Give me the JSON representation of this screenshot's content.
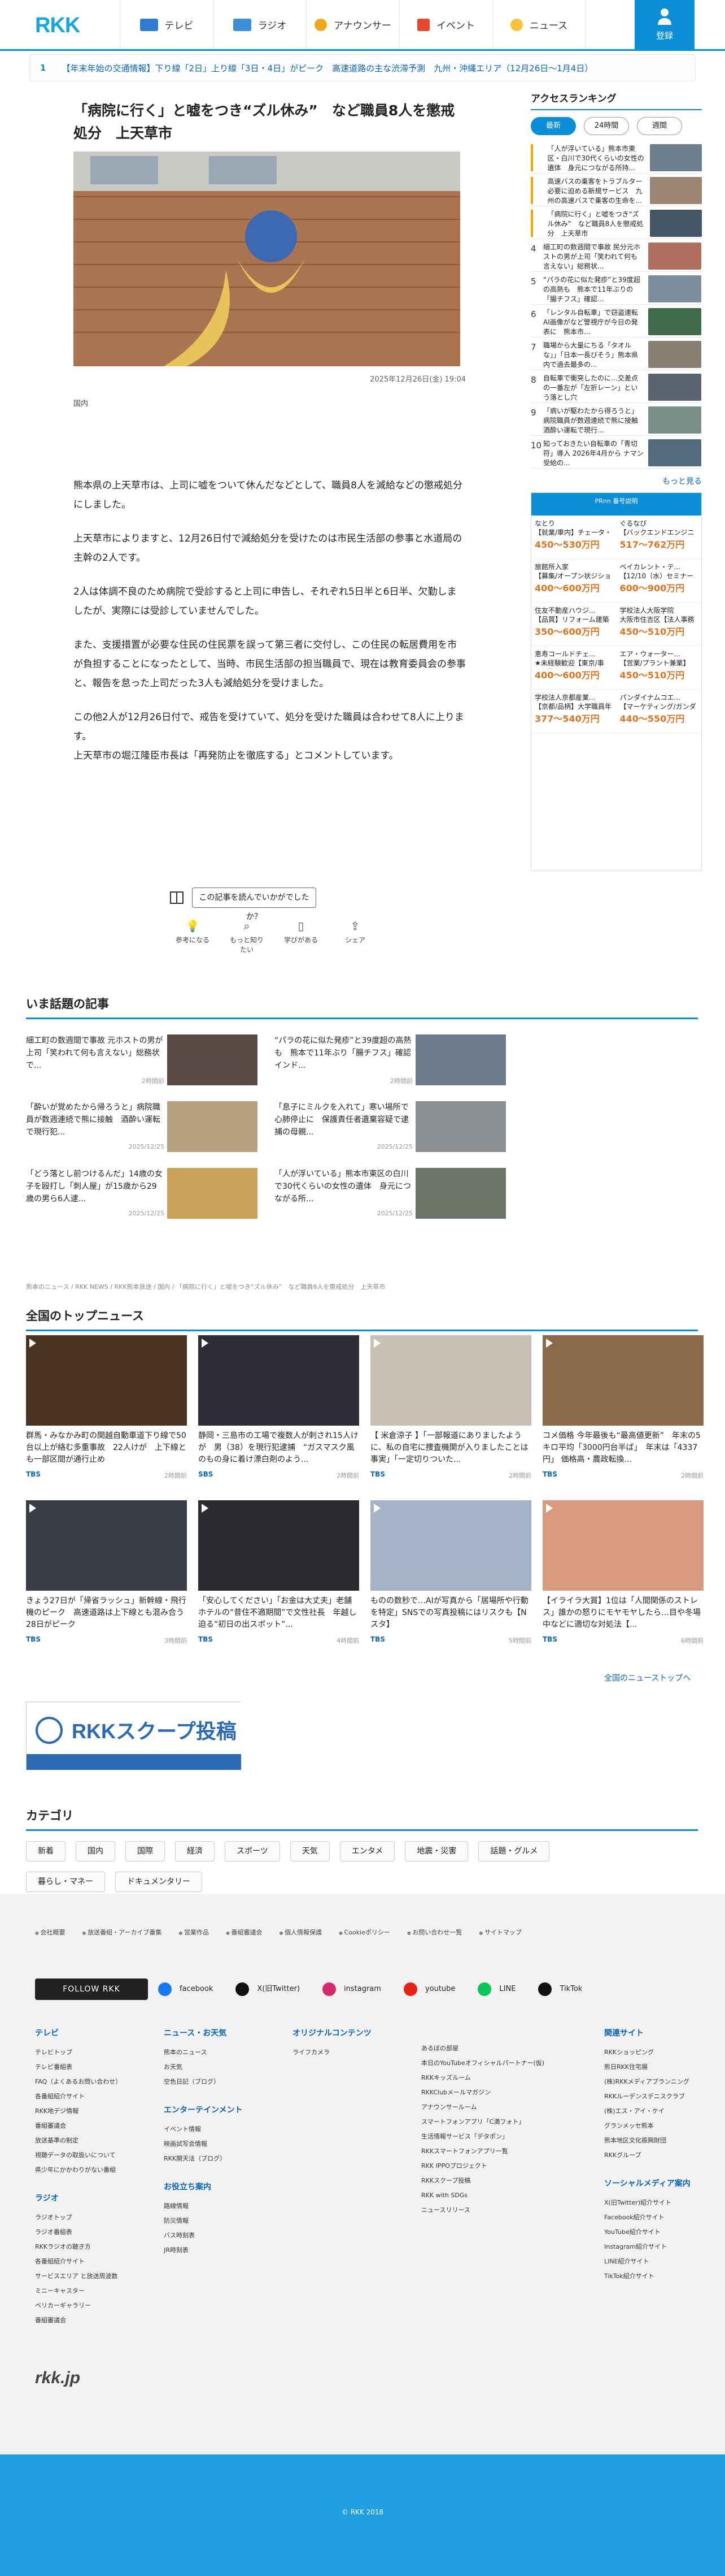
{
  "header": {
    "logo": "RKK",
    "nav": [
      "テレビ",
      "ラジオ",
      "アナウンサー",
      "イベント",
      "ニュース"
    ],
    "login": "登録"
  },
  "ticker": {
    "num": "1",
    "text": "【年末年始の交通情報】下り線「2日」上り線「3日・4日」がピーク　高速道路の主な渋滞予測　九州・沖縄エリア（12月26日〜1月4日）"
  },
  "article": {
    "title": "「病院に行く」と嘘をつき“ズル休み”　など職員8人を懲戒処分　上天草市",
    "date": "2025年12月26日(金) 19:04",
    "category": "国内",
    "paragraphs": [
      "熊本県の上天草市は、上司に嘘をついて休んだなどとして、職員8人を減給などの懲戒処分にしました。",
      "上天草市によりますと、12月26日付で減給処分を受けたのは市民生活部の参事と水道局の主幹の2人です。",
      "2人は体調不良のため病院で受診すると上司に申告し、それぞれ5日半と6日半、欠勤しましたが、実際には受診していませんでした。",
      "また、支援措置が必要な住民の住民票を誤って第三者に交付し、この住民の転居費用を市が負担することになったとして、当時、市民生活部の担当職員で、現在は教育委員会の参事と、報告を怠った上司だった3人も減給処分を受けました。",
      "この他2人が12月26日付で、戒告を受けていて、処分を受けた職員は合わせて8人に上ります。\n上天草市の堀江隆臣市長は「再発防止を徹底する」とコメントしています。"
    ],
    "question": "この記事を読んでいかがでしたか？",
    "reactions": [
      "参考になる",
      "もっと知りたい",
      "学びがある",
      "シェア"
    ]
  },
  "ranking": {
    "title": "アクセスランキング",
    "tabs": [
      "最新",
      "24時間",
      "週間"
    ],
    "items": [
      {
        "n": "",
        "t": "「人が浮いている」熊本市東区・白川で30代くらいの女性の遺体　身元につながる所持..."
      },
      {
        "n": "",
        "t": "高速バスの乗客をトラブルター必要に迫める新規サービス　九州の高速バスで乗客の生命を..."
      },
      {
        "n": "",
        "t": "「病院に行く」と嘘をつき“ズル休み”　など職員8人を懲戒処分　上天草市"
      },
      {
        "n": "4",
        "t": "細工町の数週間で事故 民分元ホストの男が上司「笑われて何も言えない」総務状..."
      },
      {
        "n": "5",
        "t": "“パラの花に似た発疹”と39度超の高熱も　熊本で11年ぶりの「腸チフス」確認..."
      },
      {
        "n": "6",
        "t": "「レンタル自転車」で窃盗連転 AI画像がなど警視庁が今日の発表に　熊本市..."
      },
      {
        "n": "7",
        "t": "職場から大量にちる「タオルな」」「日本一長びそう」熊本県内で過去最多の..."
      },
      {
        "n": "8",
        "t": "自転車で衝突したのに…交差点の一番左が「左折レーン」という落とし穴"
      },
      {
        "n": "9",
        "t": "「病いが駆わたから得ろうと」病院職員が数週連続で熊に接触　酒酔い運転で現行..."
      },
      {
        "n": "10",
        "t": "知っておきたい自転車の「青切符」導入 2026年4月から ナマン受給の..."
      }
    ],
    "more": "もっと見る"
  },
  "ad": {
    "top": "PRnn 番号説明",
    "items": [
      {
        "t": "なとり\n【就業/車内】チェータ・ロールカバスで入院",
        "p": "450〜530万円"
      },
      {
        "t": "ぐるなび\n【バックエンドエンジニア（ぐるなび）】",
        "p": "517〜762万円"
      },
      {
        "t": "旅館所入家\n【募集/オープン状ジション】営業部の...",
        "p": "400〜600万円"
      },
      {
        "t": "ベイカレント・テ...\n【12/10（水）セミナー開催/ITエンジニア...",
        "p": "600〜900万円"
      },
      {
        "t": "住友不動産ハウジ...\n【品質】リフォーム建築施工管理職/未...",
        "p": "350〜600万円"
      },
      {
        "t": "学校法人大阪学院\n大阪市住吉区【法人事務局/大学の高校..】",
        "p": "450〜510万円"
      },
      {
        "t": "恵寿コールドチェ...\n★未経験歓迎【東京/事務】「資訊ため」を...",
        "p": "400〜600万円"
      },
      {
        "t": "エア・ウォーター...\n【営業/プラント兼業】（空調・冷蔵・冷凍...",
        "p": "450〜510万円"
      },
      {
        "t": "学校法人京都産業...\n【京都/品柄】大学職員年令年3日の...",
        "p": "377〜540万円"
      },
      {
        "t": "パンダイナムコエ...\n【マーケティング/ガンダムコンテンツ...",
        "p": "440〜550万円"
      }
    ]
  },
  "topics": {
    "title": "いま話題の記事",
    "items": [
      {
        "t": "細工町の数週間で事故 元ホストの男が上司「笑われて何も言えない」総務状で...",
        "m": "2時間前"
      },
      {
        "t": "“パラの花に似た発疹”と39度超の高熱も　熊本で11年ぶり「腸チフス」確認　インド...",
        "m": "2時間前"
      },
      {
        "t": "「酔いが覚めたから帰ろうと」病院職員が数週連続で熊に接触　酒酔い運転で現行犯...",
        "m": "2025/12/25"
      },
      {
        "t": "「息子にミルクを入れて」寒い場所で心肺停止に　保護責任者遺棄容疑で逮捕の母親...",
        "m": "2025/12/25"
      },
      {
        "t": "「どう落とし前つけるんだ」14歳の女子を殴打し「刺人屋」が15歳から29歳の男ら6人逮...",
        "m": "2025/12/25"
      },
      {
        "t": "「人が浮いている」熊本市東区の白川で30代くらいの女性の遺体　身元につながる所...",
        "m": "2025/12/25"
      }
    ]
  },
  "breadcrumb": "熊本のニュース / RKK NEWS / RKK熊本放送 / 国内 / 「病院に行く」と嘘をつき“ズル休み”　など職員8人を懲戒処分　上天草市",
  "topnews": {
    "title": "全国のトップニュース",
    "items": [
      {
        "t": "群馬・みなかみ町の関越自動車道下り線で50台以上が絡む多重事故　22人けが　上下線とも一部区間が通行止め",
        "s": "TBS",
        "d": "2時間前"
      },
      {
        "t": "静岡・三島市の工場で複数人が刺され15人けが　男（38）を現行犯逮捕　“ガスマスク風のもの身に着け漂白剤のよう...",
        "s": "SBS",
        "d": "2時間前"
      },
      {
        "t": "【 米倉涼子 】「一部報道にありましたように、私の自宅に捜査機関が入りましたことは事実」「一定切りついた...",
        "s": "TBS",
        "d": "2時間前"
      },
      {
        "t": "コメ価格 今年最後も“最高値更新”　年末の5キロ平均「3000円台半ば」　年末は「4337円」 価格高・農政転換...",
        "s": "TBS",
        "d": "2時間前"
      },
      {
        "t": "きょう27日が「帰省ラッシュ」新幹線・飛行機のピーク　高速道路は上下線とも混み合う28日がピーク",
        "s": "TBS",
        "d": "3時間前"
      },
      {
        "t": "「安心してください」「お金は大丈夫」老舗ホテルの“昔住不適期間”で文性社長　年越し迫る“初日の出スポット”...",
        "s": "TBS",
        "d": "4時間前"
      },
      {
        "t": "ものの数秒で…AIが写真から「居場所や行動を特定」SNSでの写真投稿にはリスクも【N スタ】",
        "s": "TBS",
        "d": "5時間前"
      },
      {
        "t": "【イライラ大賞】1位は「人間関係のストレス」誰かの怒りにモヤモヤしたら…目や冬場中などに適切な対処法【...",
        "s": "TBS",
        "d": "6時間前"
      }
    ],
    "all": "全国のニューストップへ"
  },
  "banner": {
    "text": "RKKスクープ投稿"
  },
  "categories": {
    "title": "カテゴリ",
    "items": [
      "新着",
      "国内",
      "国際",
      "経済",
      "スポーツ",
      "天気",
      "エンタメ",
      "地震・災害",
      "話題・グルメ",
      "暮らし・マネー",
      "ドキュメンタリー"
    ]
  },
  "footer": {
    "links": [
      "会社概要",
      "放送番組・アーカイブ番集",
      "営業作品",
      "番組審議会",
      "個人情報保護",
      "Cookieポリシー",
      "お問い合わせ一覧",
      "サイトマップ"
    ],
    "follow": "FOLLOW RKK",
    "social": [
      "facebook",
      "X(旧Twitter)",
      "instagram",
      "youtube",
      "LINE",
      "TikTok"
    ],
    "cols": [
      {
        "h": "テレビ",
        "items": [
          "テレビトップ",
          "テレビ番組表",
          "FAQ（よくあるお問い合わせ）",
          "各番組紹介サイト",
          "RKK地デジ情報",
          "番組審議会",
          "放送基準の制定",
          "視聴データの取扱いについて",
          "県少年にかかわりがない番組"
        ]
      },
      {
        "h": "ニュース・お天気",
        "items": [
          "熊本のニュース",
          "お天気",
          "空色日記（ブログ）"
        ]
      },
      {
        "h": "オリジナルコンテンツ",
        "items": [
          "ライフカメラ"
        ]
      },
      {
        "h": "",
        "items": [
          "あるぼの部屋",
          "本日のYouTubeオフィシャルパートナー(仮)",
          "RKKキッズルーム",
          "RKKClubメールマガジン",
          "アナウンサールーム",
          "スマートフォンアプリ「C満フォト」",
          "生活情報サービス「デタポン」",
          "RKKスマートフォンアプリ一覧",
          "RKK IPPOプロジェクト",
          "RKKスクープ投稿",
          "RKK with SDGs",
          "ニュースリリース"
        ]
      },
      {
        "h": "関連サイト",
        "items": [
          "RKKショッピング",
          "熊日RKK住宅展",
          "(株)RKKメディアプランニング",
          "RKKルーデンスデニスクラブ",
          "(株)エス・アイ・ケイ",
          "グランメッセ熊本",
          "熊本地区文化振興財団",
          "RKKグループ"
        ]
      }
    ],
    "cols2": [
      {
        "h": "ラジオ",
        "items": [
          "ラジオトップ",
          "ラジオ番組表",
          "RKKラジオの聴き方",
          "各番組紹介サイト",
          "サービスエリア と放送周波数",
          "ミニーキャスター",
          "ベリカーギャラリー",
          "番組審議会"
        ]
      },
      {
        "h": "エンターテインメント",
        "items": [
          "イベント情報",
          "映画試写会情報",
          "RKK開天法（ブログ）"
        ]
      },
      {
        "h": "お役立ち案内",
        "items": [
          "路線情報",
          "防災情報",
          "バス時刻表",
          "JR時刻表"
        ]
      },
      {
        "h": "ソーシャルメディア案内",
        "items": [
          "X(旧Twitter)紹介サイト",
          "Facebook紹介サイト",
          "YouTube紹介サイト",
          "Instagram紹介サイト",
          "LINE紹介サイト",
          "TikTok紹介サイト"
        ]
      }
    ],
    "site": "rkk.jp",
    "copyright": "© RKK 2018"
  },
  "colors": {
    "accent": "#0a8fd6",
    "link": "#0a65b8",
    "price": "#e0731f"
  }
}
